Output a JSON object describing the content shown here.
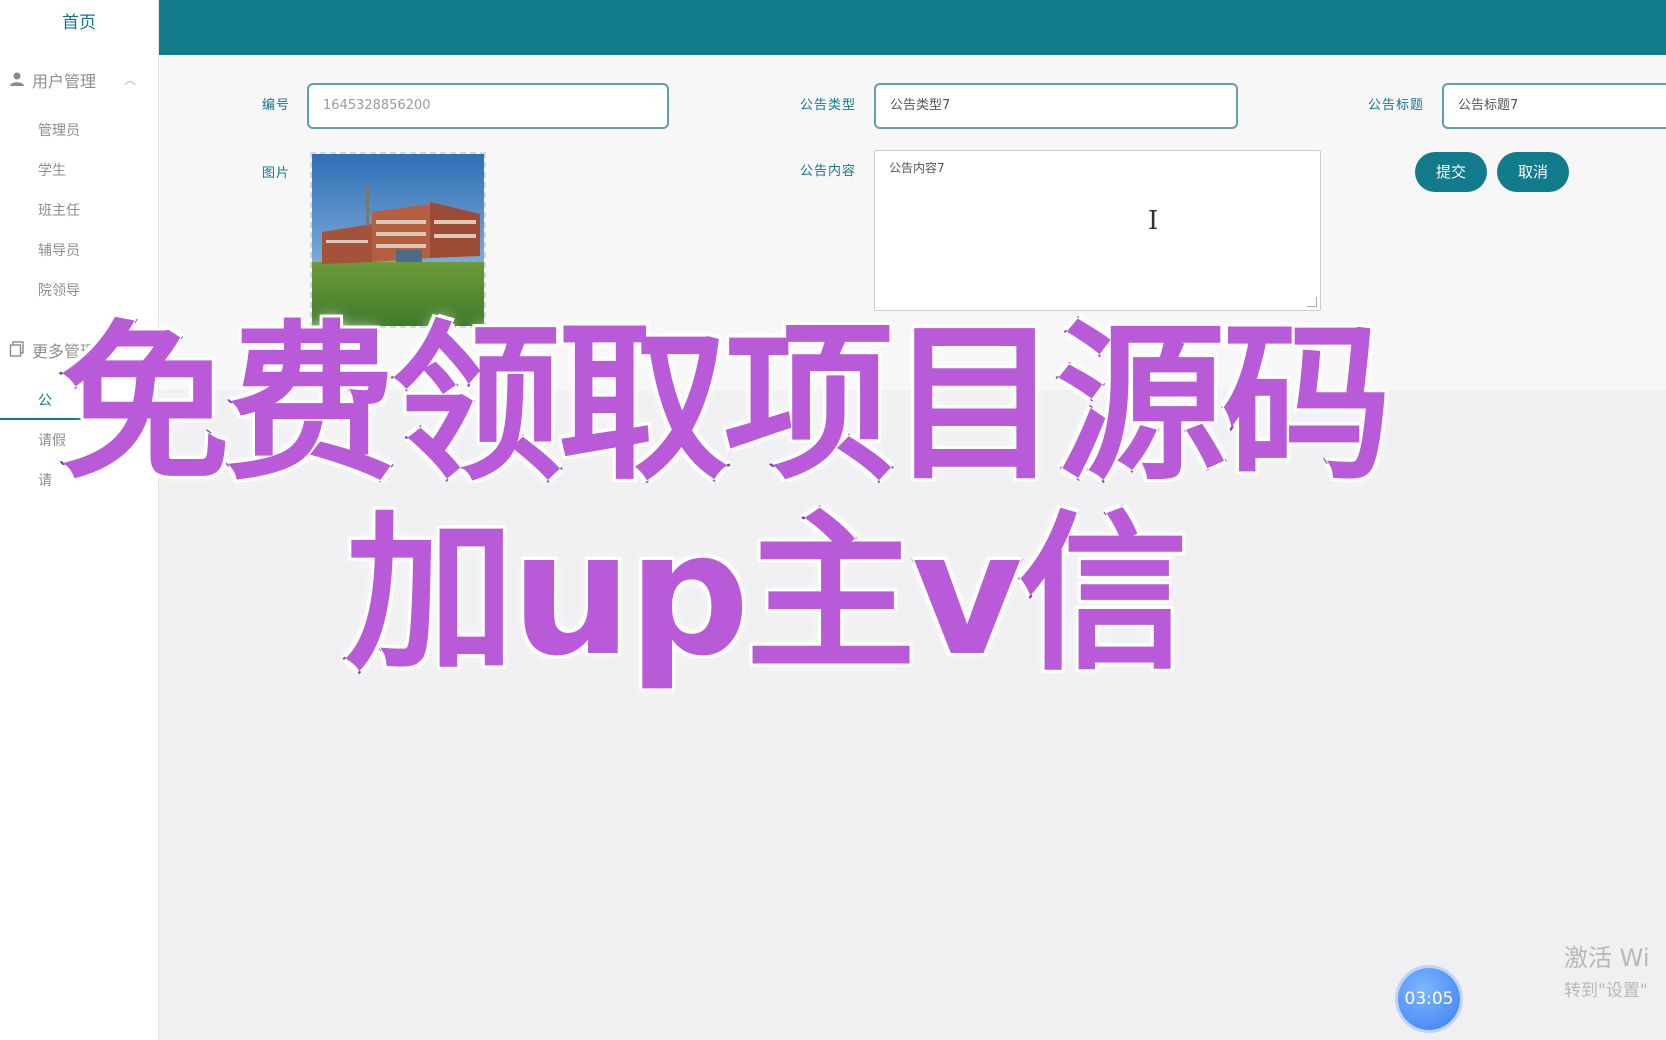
{
  "sidebar": {
    "home": "首页",
    "groups": [
      {
        "label": "用户管理",
        "icon": "user-icon"
      },
      {
        "label": "更多管理",
        "icon": "copy-icon"
      }
    ],
    "user_items": [
      "管理员",
      "学生",
      "班主任",
      "辅导员",
      "院领导"
    ],
    "more_items": [
      "公",
      "请假",
      "请"
    ]
  },
  "form": {
    "labels": {
      "id": "编号",
      "type": "公告类型",
      "title": "公告标题",
      "image": "图片",
      "content": "公告内容"
    },
    "id_value": "1645328856200",
    "type_value": "公告类型7",
    "title_value": "公告标题7",
    "content_value": "公告内容7",
    "submit": "提交",
    "cancel": "取消"
  },
  "overlay": {
    "line1": "免费领取项目源码",
    "line2": "加up主v信"
  },
  "system": {
    "watermark_line1": "激活 Wi",
    "watermark_line2": "转到\"设置\"",
    "timer": "03:05"
  },
  "colors": {
    "accent": "#127b8c",
    "overlay_fill": "#b95ad8",
    "overlay_stroke": "#6b1aa3"
  }
}
